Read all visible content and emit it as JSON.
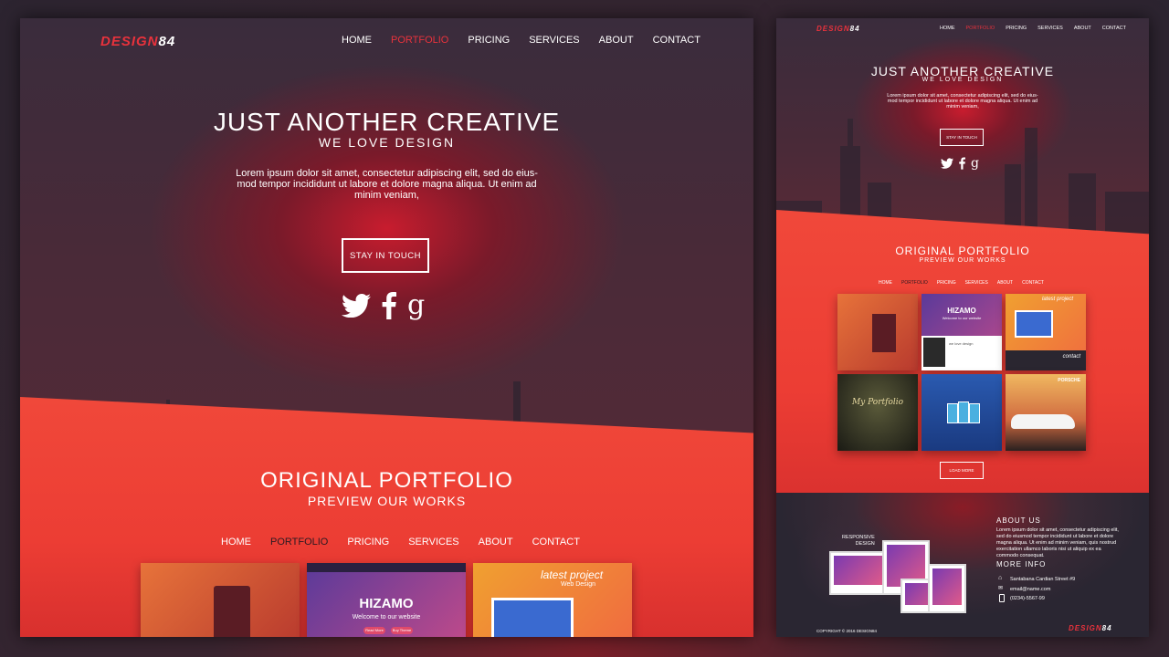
{
  "logo": {
    "text_a": "DESIGN",
    "text_b": "84"
  },
  "nav": [
    "HOME",
    "PORTFOLIO",
    "PRICING",
    "SERVICES",
    "ABOUT",
    "CONTACT"
  ],
  "nav_active": "PORTFOLIO",
  "hero": {
    "title": "JUST ANOTHER CREATIVE",
    "subtitle": "WE LOVE DESIGN",
    "body": "Lorem ipsum dolor sit amet, consectetur adipiscing elit, sed do eius-mod tempor incididunt ut labore et dolore magna aliqua. Ut enim ad minim veniam,",
    "button": "STAY IN TOUCH",
    "social_icons": [
      "twitter-icon",
      "facebook-icon",
      "google-plus-icon"
    ]
  },
  "portfolio": {
    "title": "ORIGINAL PORTFOLIO",
    "subtitle": "PREVIEW OUR WORKS",
    "tabs": [
      "HOME",
      "PORTFOLIO",
      "PRICING",
      "SERVICES",
      "ABOUT",
      "CONTACT"
    ],
    "load_more": "LOAD MORE",
    "thumbs": {
      "hizamo_title": "HIZAMO",
      "hizamo_sub": "Welcome to our website",
      "hizamo_btn1": "Read More",
      "hizamo_btn2": "Buy Theme",
      "latest_title": "latest project",
      "latest_sub": "Web Design",
      "latest_text": "Lorem ipsum dolor sit amet consectetur adipiscing",
      "contact_label": "contact",
      "my_portfolio": "My Portfolio",
      "porsche": "PORSCHE",
      "we_love": "we love design"
    }
  },
  "about": {
    "title": "ABOUT US",
    "text": "Lorem ipsum dolor sit amet, consectetur adipiscing elit, sed do eiusmod tempor incididunt ut labore et dolore magna aliqua. Ut enim ad minim veniam, quis nostrud exercitation ullamco laboris nisi ut aliquip ex ea commodo consequat.",
    "more_title": "MORE INFO",
    "address": "Santabana Cardian Street #9",
    "email": "email@name.com",
    "phone": "(0234)-5567-99",
    "responsive_label": "RESPONSIVE\nDESIGN",
    "copyright": "COPYRIGHT © 2016 DESIGN84"
  },
  "colors": {
    "accent": "#e8323c",
    "orange": "#ef4537",
    "dark": "#3a2c3c"
  }
}
